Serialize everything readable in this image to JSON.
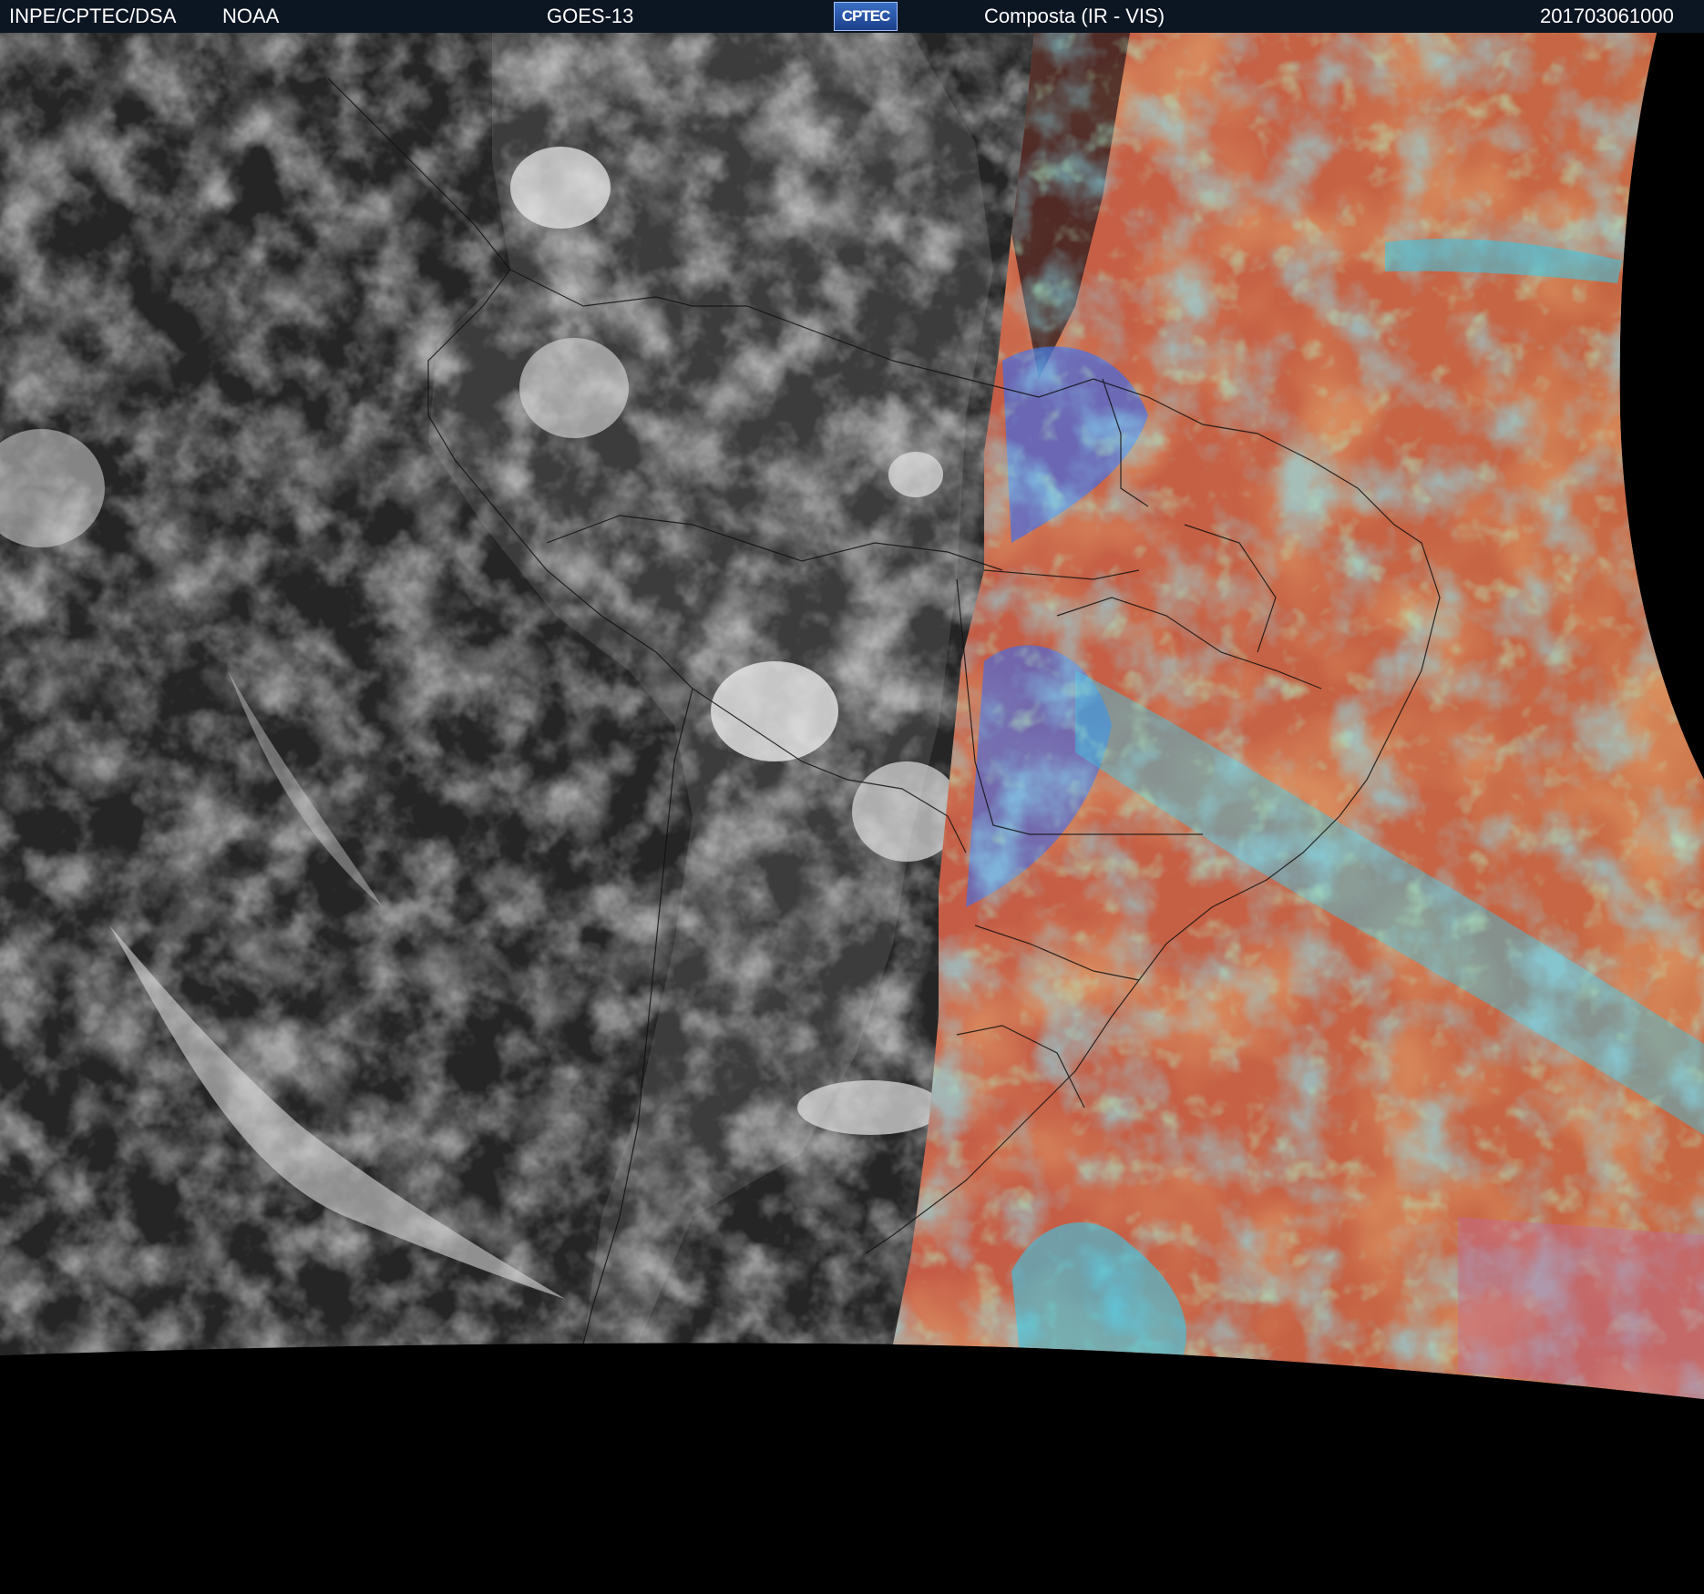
{
  "header": {
    "source": "INPE/CPTEC/DSA",
    "agency": "NOAA",
    "satellite": "GOES-13",
    "logo_text": "CPTEC",
    "product": "Composta (IR - VIS)",
    "timestamp": "201703061000"
  },
  "colors": {
    "header_bg": "#0c1522",
    "ir_dark": "#2a2a2a",
    "ir_cloud": "#d8d8d8",
    "vis_base": "#c4504a",
    "vis_orange": "#c8783e",
    "vis_cyan": "#38c8e8",
    "vis_blue": "#3a6cf0",
    "vis_green": "#70e090",
    "vis_pink": "#c06aa0",
    "border_line": "#111111"
  }
}
